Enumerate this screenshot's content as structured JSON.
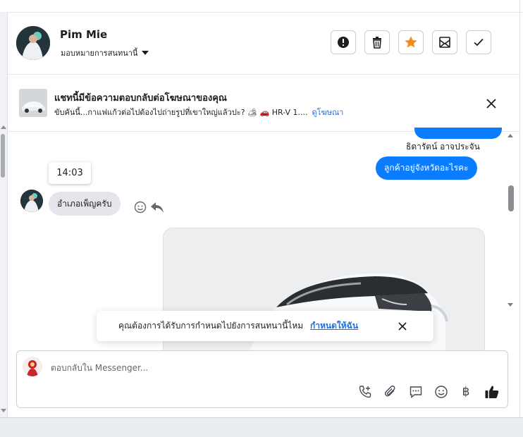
{
  "header": {
    "contact_name": "Pim Mie",
    "assign_label": "มอบหมายการสนทนานี้",
    "actions": [
      {
        "name": "report",
        "icon": "exclamation-icon"
      },
      {
        "name": "delete",
        "icon": "trash-icon"
      },
      {
        "name": "star",
        "icon": "star-icon",
        "color": "#f28a1e"
      },
      {
        "name": "spam",
        "icon": "spam-icon"
      },
      {
        "name": "done",
        "icon": "check-icon"
      }
    ]
  },
  "ad_banner": {
    "title": "แชทนี้มีข้อความตอบกลับต่อโฆษณาของคุณ",
    "subtitle": "ขับคันนี้...กาแฟแก้วต่อไปต้องไปถ่ายรูปที่เขาใหญ่แล้วปะ? 🏕 🚗 HR-V 1....",
    "link_label": "ดูโฆษณา"
  },
  "conversation": {
    "outgoing_sender": "ธิดารัตน์ อาจประจัน",
    "outgoing_message": "ลูกค้าอยู่จังหวัดอะไรคะ",
    "timestamp": "14:03",
    "incoming_message": "อำเภอเพ็ญครับ"
  },
  "toast": {
    "text": "คุณต้องการได้รับการกำหนดไปยังการสนทนานี้ไหม",
    "link": "กำหนดให้ฉัน"
  },
  "composer": {
    "placeholder": "ตอบกลับใน Messenger...",
    "baht_symbol": "฿"
  },
  "colors": {
    "accent": "#0a7cff",
    "link": "#216fdb",
    "like": "#1c1e21"
  }
}
